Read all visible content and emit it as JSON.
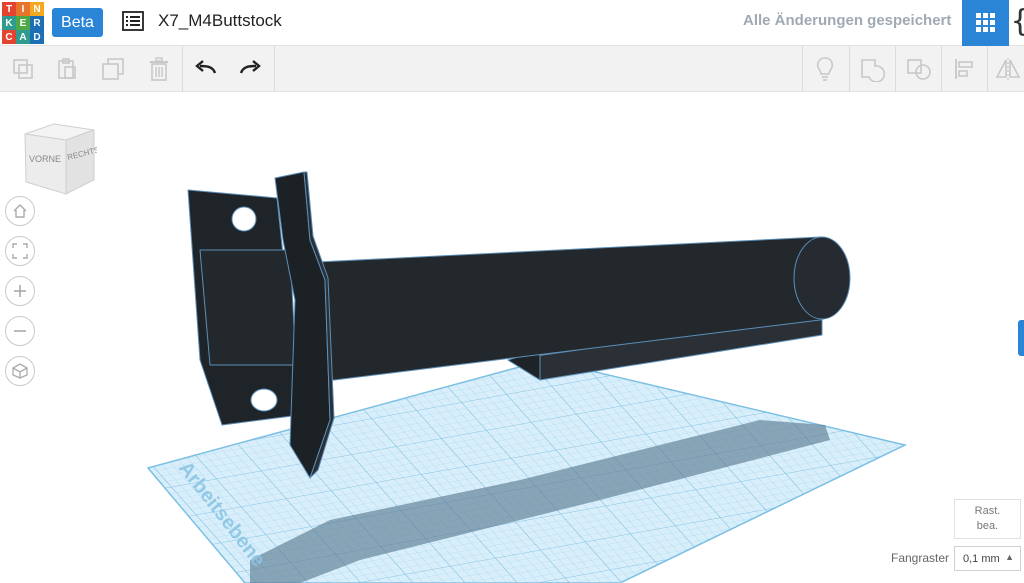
{
  "app": {
    "logo_letters": [
      "T",
      "I",
      "N",
      "K",
      "E",
      "R",
      "C",
      "A",
      "D"
    ],
    "logo_colors": [
      "#e2442f",
      "#e8732a",
      "#f4a81f",
      "#2f9b8e",
      "#4ea845",
      "#1d6fb5",
      "#e2442f",
      "#2f9b8e",
      "#1d6fb5"
    ],
    "beta_label": "Beta",
    "design_name": "X7_M4Buttstock",
    "save_status": "Alle Änderungen gespeichert",
    "code_glyph": "{"
  },
  "toolbar": {
    "tools": [
      {
        "name": "copy-icon"
      },
      {
        "name": "paste-icon"
      },
      {
        "name": "duplicate-icon"
      },
      {
        "name": "delete-icon"
      },
      {
        "name": "undo-icon"
      },
      {
        "name": "redo-icon"
      },
      {
        "name": "lightbulb-icon"
      },
      {
        "name": "group-icon"
      },
      {
        "name": "ungroup-icon"
      },
      {
        "name": "align-icon"
      },
      {
        "name": "mirror-icon"
      }
    ]
  },
  "viewcube": {
    "front_label": "VORNE",
    "right_label": "RECHTS"
  },
  "view_controls": [
    {
      "name": "home-icon"
    },
    {
      "name": "fit-view-icon"
    },
    {
      "name": "zoom-in-icon"
    },
    {
      "name": "zoom-out-icon"
    },
    {
      "name": "perspective-icon"
    }
  ],
  "workplane": {
    "label": "Arbeitsebene"
  },
  "snap": {
    "edit_grid_label_line1": "Rast.",
    "edit_grid_label_line2": "bea.",
    "snap_label": "Fangraster",
    "snap_value": "0,1 mm"
  },
  "colors": {
    "accent": "#2b85d6",
    "model": "#22272c",
    "model_edge": "#5d8fb8",
    "grid": "#bfe0f2",
    "grid_line": "#8cc6e6"
  }
}
